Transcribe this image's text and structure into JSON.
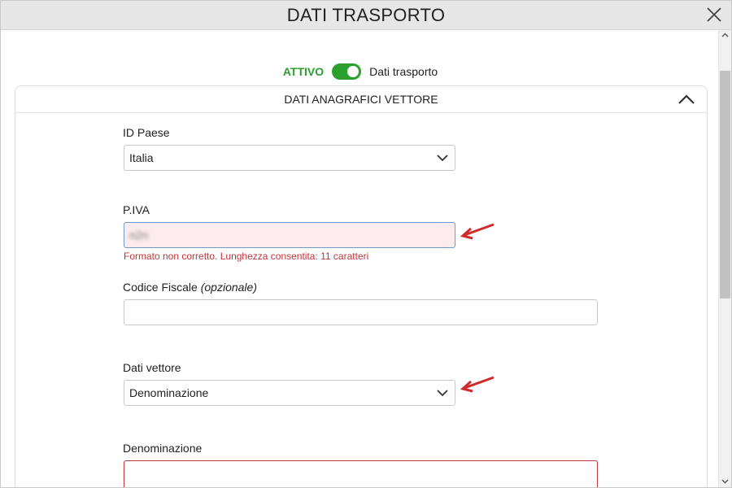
{
  "window": {
    "title": "DATI TRASPORTO"
  },
  "toggle": {
    "status": "ATTIVO",
    "label": "Dati trasporto"
  },
  "panel": {
    "title": "DATI ANAGRAFICI VETTORE"
  },
  "fields": {
    "id_paese": {
      "label": "ID Paese",
      "value": "Italia"
    },
    "piva": {
      "label": "P.IVA",
      "value": "n2n",
      "error": "Formato non corretto. Lunghezza consentita: 11 caratteri"
    },
    "codice_fiscale": {
      "label": "Codice Fiscale",
      "optional": "(opzionale)",
      "value": ""
    },
    "dati_vettore": {
      "label": "Dati vettore",
      "value": "Denominazione"
    },
    "denominazione": {
      "label": "Denominazione",
      "value": ""
    }
  },
  "colors": {
    "accent_green": "#2aa02f",
    "error_red": "#c0353a",
    "arrow_red": "#d02a2a"
  }
}
